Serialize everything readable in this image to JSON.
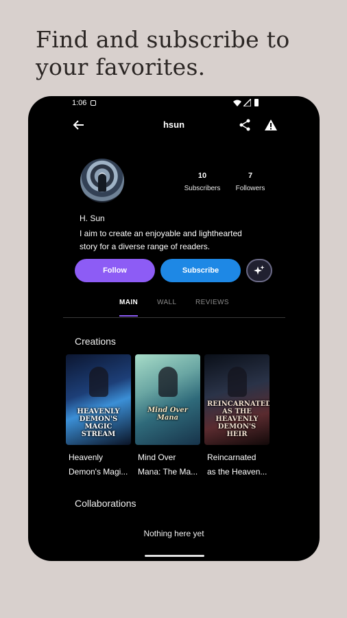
{
  "headline": {
    "line1": "Find and subscribe to",
    "line2": "your favorites."
  },
  "status": {
    "time": "1:06"
  },
  "topbar": {
    "title": "hsun"
  },
  "profile": {
    "subscribers_count": "10",
    "subscribers_label": "Subscribers",
    "followers_count": "7",
    "followers_label": "Followers",
    "name": "H. Sun",
    "bio_line1": "I aim to create an enjoyable and lighthearted",
    "bio_line2": "story for a diverse range of readers."
  },
  "actions": {
    "follow": "Follow",
    "subscribe": "Subscribe"
  },
  "tabs": [
    {
      "label": "MAIN"
    },
    {
      "label": "WALL"
    },
    {
      "label": "REVIEWS"
    }
  ],
  "creations": {
    "title": "Creations",
    "items": [
      {
        "cover_text": "HEAVENLY DEMON'S MAGIC STREAM",
        "line1": "Heavenly",
        "line2": "Demon's Magi..."
      },
      {
        "cover_text": "Mind Over Mana",
        "line1": "Mind Over",
        "line2": "Mana: The Ma..."
      },
      {
        "cover_text": "REINCARNATED AS THE HEAVENLY DEMON'S HEIR",
        "line1": "Reincarnated",
        "line2": "as the Heaven..."
      }
    ]
  },
  "collaborations": {
    "title": "Collaborations",
    "empty": "Nothing here yet"
  },
  "colors": {
    "follow": "#8d5cf5",
    "subscribe": "#1e88e5",
    "background": "#d8d0cd",
    "screen": "#000000"
  },
  "icons": [
    "back-arrow-icon",
    "share-icon",
    "warning-icon",
    "sparkle-icon",
    "wifi-icon",
    "signal-icon",
    "battery-icon"
  ]
}
